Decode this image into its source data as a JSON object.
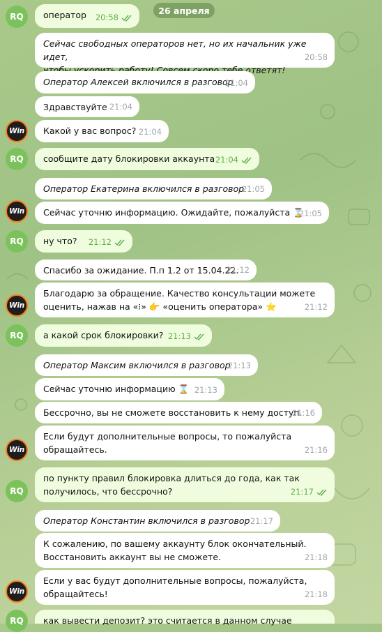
{
  "date_label": "26 апреля",
  "messages": [
    {
      "text": "оператор",
      "time": "20:58",
      "italic": false
    },
    {
      "text": "Сейчас свободных операторов нет, но их начальник уже идет,\nчтобы ускорить работу! Совсем скоро тебе ответят!",
      "time": "20:58",
      "italic": true
    },
    {
      "text": "Оператор Алексей включился в разговор",
      "time": "21:04",
      "italic": true
    },
    {
      "text": "Здравствуйте",
      "time": "21:04",
      "italic": false
    },
    {
      "text": "Какой у вас вопрос?",
      "time": "21:04",
      "italic": false
    },
    {
      "text": "сообщите дату блокировки аккаунта",
      "time": "21:04",
      "italic": false
    },
    {
      "text": "Оператор Екатерина включился в разговор",
      "time": "21:05",
      "italic": true
    },
    {
      "text": "Сейчас уточню информацию. Ожидайте, пожалуйста ⌛",
      "time": "21:05",
      "italic": false
    },
    {
      "text": "ну что?",
      "time": "21:12",
      "italic": false
    },
    {
      "text": "Спасибо за ожидание. П.п 1.2 от 15.04.22.",
      "time": "21:12",
      "italic": false
    },
    {
      "text": "Благодарю за обращение. Качество консультации можете\nоценить, нажав на «⁝» 👉 «оценить оператора» ⭐",
      "time": "21:12",
      "italic": false
    },
    {
      "text": "а какой срок блокировки?",
      "time": "21:13",
      "italic": false
    },
    {
      "text": "Оператор Максим включился в разговор",
      "time": "21:13",
      "italic": true
    },
    {
      "text": "Сейчас уточню информацию ⌛",
      "time": "21:13",
      "italic": false
    },
    {
      "text": "Бессрочно, вы не сможете восстановить к нему доступ.",
      "time": "21:16",
      "italic": false
    },
    {
      "text": "Если будут дополнительные вопросы, то пожалуйста\nобращайтесь.",
      "time": "21:16",
      "italic": false
    },
    {
      "text": "по пункту правил блокировка длиться до года, как так\nполучилось, что бессрочно?",
      "time": "21:17",
      "italic": false
    },
    {
      "text": "Оператор Константин включился в разговор",
      "time": "21:17",
      "italic": true
    },
    {
      "text": "К сожалению, по вашему аккаунту блок окончательный.\nВосстановить аккаунт вы не сможете.",
      "time": "21:18",
      "italic": false
    },
    {
      "text": "Если у вас будут дополнительные вопросы, пожалуйста,\nобращайтесь!",
      "time": "21:18",
      "italic": false
    },
    {
      "text": "как вывести депозит? это считается в данном случае",
      "time": "",
      "italic": false
    }
  ],
  "avatars": {
    "user": "RQ",
    "operator": "Win"
  },
  "colors": {
    "incoming_bubble": "#ffffff",
    "outgoing_bubble": "#effdde",
    "read_tick": "#5fae4e",
    "rq_avatar": "#7cc25c",
    "win_ring": "#ff7a1a"
  }
}
